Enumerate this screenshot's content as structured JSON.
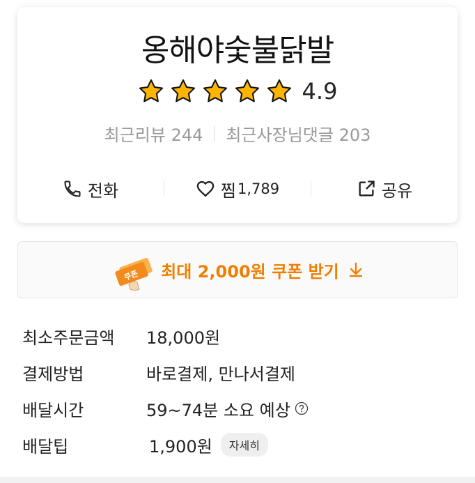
{
  "store": {
    "name": "옹해야숯불닭발",
    "rating": "4.9",
    "rating_stars": 5
  },
  "reviews": {
    "recent_review_label": "최근리뷰",
    "recent_review_count": "244",
    "owner_reply_label": "최근사장님댓글",
    "owner_reply_count": "203"
  },
  "actions": {
    "call_label": "전화",
    "like_label": "찜",
    "like_count": "1,789",
    "share_label": "공유"
  },
  "coupon": {
    "label": "최대 2,000원 쿠폰 받기",
    "icon_text": "쿠폰",
    "accent": "#f07f00"
  },
  "info": {
    "min_order_label": "최소주문금액",
    "min_order_value": "18,000원",
    "payment_label": "결제방법",
    "payment_value": "바로결제, 만나서결제",
    "delivery_time_label": "배달시간",
    "delivery_time_value": "59~74분 소요 예상",
    "delivery_tip_label": "배달팁",
    "delivery_tip_value": "1,900원",
    "detail_button": "자세히"
  },
  "icons": {
    "star": "star-icon",
    "call": "phone-icon",
    "like": "heart-icon",
    "share": "share-icon",
    "coupon": "coupon-icon",
    "download": "download-icon",
    "help": "help-icon"
  }
}
